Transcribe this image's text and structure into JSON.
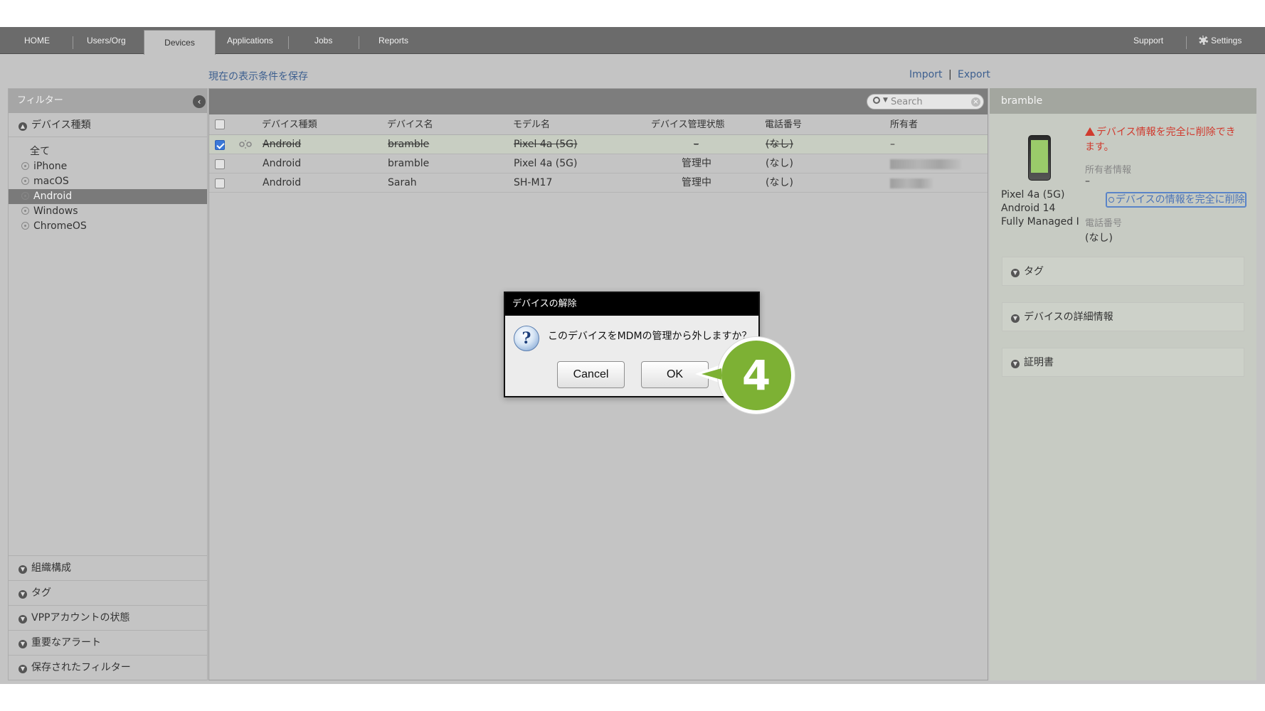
{
  "nav": {
    "tabs": [
      "HOME",
      "Users/Org",
      "Devices",
      "Applications",
      "Jobs",
      "Reports"
    ],
    "active_tab": "Devices",
    "support": "Support",
    "settings": "Settings"
  },
  "toolbar_links": {
    "save_view": "現在の表示条件を保存",
    "import": "Import",
    "separator": "|",
    "export": "Export"
  },
  "filter_panel": {
    "title": "フィルター",
    "device_type_section": "デバイス種類",
    "items": [
      "全て",
      "iPhone",
      "macOS",
      "Android",
      "Windows",
      "ChromeOS"
    ],
    "active_item": "Android",
    "bottom_sections": [
      "組織構成",
      "タグ",
      "VPPアカウントの状態",
      "重要なアラート",
      "保存されたフィルター"
    ]
  },
  "table": {
    "search_placeholder": "Search",
    "columns": [
      "デバイス種類",
      "デバイス名",
      "モデル名",
      "デバイス管理状態",
      "電話番号",
      "所有者"
    ],
    "rows": [
      {
        "type": "Android",
        "name": "bramble",
        "model": "Pixel 4a (5G)",
        "status": "–",
        "phone": "(なし)",
        "owner": "–",
        "checked": true
      },
      {
        "type": "Android",
        "name": "bramble",
        "model": "Pixel 4a (5G)",
        "status": "管理中",
        "phone": "(なし)",
        "owner": "",
        "checked": false
      },
      {
        "type": "Android",
        "name": "Sarah",
        "model": "SH-M17",
        "status": "管理中",
        "phone": "(なし)",
        "owner": "",
        "checked": false
      }
    ]
  },
  "dialog": {
    "title": "デバイスの解除",
    "message": "このデバイスをMDMの管理から外しますか？",
    "cancel": "Cancel",
    "ok": "OK"
  },
  "callout": {
    "number": "4",
    "color": "#7db134"
  },
  "detail_panel": {
    "title": "bramble",
    "model": "Pixel 4a (5G)",
    "os": "Android 14",
    "mode": "Fully Managed I",
    "warning": "デバイス情報を完全に削除できます。",
    "owner_label": "所有者情報",
    "owner_value": "–",
    "delete_link": "デバイスの情報を完全に削除",
    "phone_label": "電話番号",
    "phone_value": "(なし)",
    "sections": [
      "タグ",
      "デバイスの詳細情報",
      "証明書"
    ]
  },
  "colors": {
    "accent_link": "#3d5f8f",
    "warning": "#d03a2e",
    "selected_checkbox": "#3a78d8"
  }
}
